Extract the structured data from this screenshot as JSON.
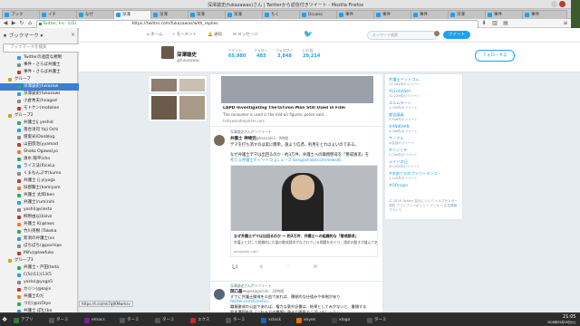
{
  "window": {
    "title": "深澤諭史(fukazawas)さん | Twitterから返信付きツイート - Mozilla Firefox"
  },
  "tabs": [
    {
      "label": "ブック"
    },
    {
      "label": "イチ"
    },
    {
      "label": "なぜ"
    },
    {
      "label": "深澤"
    },
    {
      "label": "深澤"
    },
    {
      "label": "深澤"
    },
    {
      "label": "深澤"
    },
    {
      "label": "ちく"
    },
    {
      "label": "Dcuesc"
    },
    {
      "label": "事件"
    },
    {
      "label": "事件"
    },
    {
      "label": "事件"
    },
    {
      "label": "深澤"
    },
    {
      "label": "事件"
    },
    {
      "label": "事件"
    }
  ],
  "nav": {
    "url": "https://twitter.com/fukazawas/with_replies",
    "identity": "Twitter, Inc. (US)"
  },
  "sidebar": {
    "header": "ブックマーク",
    "search_placeholder": "ブックマークを検索",
    "items": [
      {
        "label": "Twitterの過度な規制",
        "sel": false
      },
      {
        "label": "事件・さらば弁護士",
        "sel": false
      },
      {
        "label": "事件・さらば弁護士",
        "sel": false
      },
      {
        "label": "グループ",
        "sel": false
      },
      {
        "label": "深澤諭史(fukazaw",
        "sel": true
      },
      {
        "label": "深澤諭史(fukazaws",
        "sel": false
      },
      {
        "label": "小倉秀夫(hnagod",
        "sel": false
      },
      {
        "label": "モトケン(motoken",
        "sel": false
      },
      {
        "label": "グループ2",
        "sel": false
      },
      {
        "label": "弁護士(j yoshid",
        "sel": false
      },
      {
        "label": "落合洋司 Yoji Ochi",
        "sel": false
      },
      {
        "label": "壇俊光(Danblog",
        "sel": false
      },
      {
        "label": "山田悠治(yyamad",
        "sel": false
      },
      {
        "label": "Shoko Ogawa(yo",
        "sel": false
      },
      {
        "label": "清水 陽平(sho",
        "sel": false
      },
      {
        "label": "ライス法(RiceLa",
        "sel": false
      },
      {
        "label": "くまもんぷす(kuma",
        "sel": false
      },
      {
        "label": "弁護士 (j y(yoga",
        "sel": false
      },
      {
        "label": "旧郡賢士(kamiyam",
        "sel": false
      },
      {
        "label": "弁護士 太郎(ben",
        "sel": false
      },
      {
        "label": "弁護士(rumiruhi",
        "sel": false
      },
      {
        "label": "yoshi(@siesta",
        "sel": false
      },
      {
        "label": "柳原由以(bizvz",
        "sel": false
      },
      {
        "label": "弁護士 K(@lawc",
        "sel": false
      },
      {
        "label": "竹川英樹 (Takeka",
        "sel": false
      },
      {
        "label": "新潟の弁護士(xx",
        "sel": false
      },
      {
        "label": "ぽちぽち(@pochipo",
        "sel": false
      },
      {
        "label": "Mifu(@lawfuko",
        "sel": false
      },
      {
        "label": "グループ3",
        "sel": false
      },
      {
        "label": "弁護士・戸田(toda",
        "sel": false
      },
      {
        "label": "C(S)(11)(13(5",
        "sel": false
      },
      {
        "label": "yozlo(@yoga5",
        "sel": false
      },
      {
        "label": "カジン(@kajin",
        "sel": false
      },
      {
        "label": "弁護士のだ",
        "sel": false
      },
      {
        "label": "つだ(@zz5tyo",
        "sel": false
      },
      {
        "label": "弁護士 ぽむ(ba",
        "sel": false
      }
    ]
  },
  "twitter_nav": {
    "home": "ホーム",
    "moments": "モーメント",
    "notifications": "通知",
    "messages": "メッセージ",
    "search_placeholder": "キーワード検索",
    "tweet_button": "ツイート"
  },
  "profile": {
    "name": "深澤諭史",
    "handle": "@fukazawas",
    "stats": [
      {
        "label": "ツイート",
        "value": "65,980"
      },
      {
        "label": "フォロー",
        "value": "483"
      },
      {
        "label": "フォロワー",
        "value": "3,848"
      },
      {
        "label": "いいね",
        "value": "29,214"
      }
    ],
    "follow_button": "フォローする"
  },
  "link_card": {
    "title": "LAPD Investigating TheTaTiron Man Still Used in Film",
    "desc": "The consumer is used in the mid-air figures, police said...",
    "domain": "hollywoodreporter.com"
  },
  "tweet1": {
    "context": "深澤諭史さんがリツイート",
    "author": "弁護士 神崎完",
    "handle": "@kanzaki3 · 9時間",
    "line1": "デマを打ち消すのは実に簡単。施よう信憑、利用をとればよいのである。",
    "line2": "なぜ弁護士デマは出回るのか - 約3万件、弁護士への職務懲戒を「懲戒請求」を",
    "line3": "考える弁護士チャットゴ jjニュース bengoshidotcom/news/8...",
    "card_title": "なぜ弁護士デマは出回るのか ― 約3万件、弁護士への組織的な「懲戒請求」",
    "card_desc": "弁護士と対して組織的に大量の懲戒請求がなされている問題をめぐり、請求の動きが盛んである。",
    "card_domain": "bengoshi.com"
  },
  "tweet2": {
    "context": "深澤諭史さんがリツイート",
    "author": "岡口基一",
    "handle": "@okaguchik · 20時間",
    "line1": "すでに弁護士懲戒を公益であれば、積極的な仕組みや体制があり",
    "line2": "twitter.com/Ikimitsu...",
    "line3": "職業懲戒の公益であれば、権力な意外証書は、結果としてみかないと、書類する",
    "line4": "鈴木博毅先生「これまでの書類に答えて理屈でございましょう」"
  },
  "right_panel": [
    {
      "link": "弁護士ドットコム",
      "sub": "13,284件のツイート"
    },
    {
      "link": "#LLoGASHI",
      "sub": "12,226件のツイート"
    },
    {
      "link": "エルムラーン",
      "sub": "1,095件のツイート"
    },
    {
      "link": "都会議員",
      "sub": "3,508件のツイート"
    },
    {
      "link": "#ANIKHAN",
      "sub": "3,088件のツイート"
    },
    {
      "link": "サークル",
      "sub": "#会話のツイート"
    },
    {
      "link": "#ミシリテ",
      "sub": "2,094件のツイート"
    },
    {
      "link": "メイドの日",
      "sub": "49,026件のツイート"
    },
    {
      "link": "#名前でかのプツリーランス",
      "sub": "1,125件のツイート"
    },
    {
      "link": "#OOrnger",
      "sub": ""
    }
  ],
  "right_footer": "© 2018 Twitter 会社について ヘルプセンター 規約 プライバシーポリシー クッキー 広告情報 ブランド",
  "status_url": "https://t.co/mk7qtKMwmsv",
  "taskbar": [
    {
      "label": "アプリ",
      "color": "#2e7d32"
    },
    {
      "label": "ターミ",
      "color": "#555555"
    },
    {
      "label": "emacs",
      "color": "#7b1fa2"
    },
    {
      "label": "ターミ",
      "color": "#555555"
    },
    {
      "label": "ターミ",
      "color": "#555555"
    },
    {
      "label": "エクス",
      "color": "#c62828"
    },
    {
      "label": "ターミ",
      "color": "#555555"
    },
    {
      "label": "xclock",
      "color": "#1565c0"
    },
    {
      "label": "xeyes",
      "color": "#ef6c00"
    },
    {
      "label": "xlogo",
      "color": "#37474f"
    },
    {
      "label": "ターミ",
      "color": "#555555"
    }
  ],
  "clock": {
    "time": "21:05",
    "date": "2018年05月16日(火)"
  },
  "desktop": [
    {
      "label": "apply-sunaga"
    },
    {
      "label": "2018-11-25"
    },
    {
      "label": "2018-11-25"
    }
  ]
}
